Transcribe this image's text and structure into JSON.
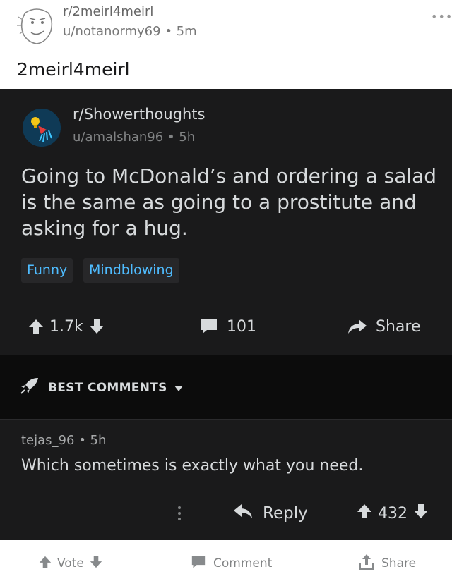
{
  "outer": {
    "subreddit": "r/2meirl4meirl",
    "user": "u/notanormy69",
    "time": "5m",
    "meta_sep": "•",
    "title": "2meirl4meirl",
    "more": "•••"
  },
  "embedded": {
    "subreddit": "r/Showerthoughts",
    "user": "u/amalshan96",
    "time": "5h",
    "meta_sep": "•",
    "body": "Going to McDonald’s and ordering a salad is the same as going to a prostitute and asking for a hug.",
    "flairs": [
      "Funny",
      "Mindblowing"
    ],
    "votes": "1.7k",
    "comments": "101",
    "share_label": "Share",
    "sort_label": "BEST COMMENTS",
    "comment": {
      "author": "tejas_96",
      "meta_sep": "•",
      "time": "5h",
      "text": "Which sometimes is exactly what you need.",
      "reply_label": "Reply",
      "votes": "432"
    }
  },
  "footer": {
    "vote_label": "Vote",
    "comment_label": "Comment",
    "share_label": "Share"
  },
  "icons": {
    "avatar": "rage-face-avatar-icon",
    "more": "more-options-icon",
    "sub_icon": "lightbulb-shower-icon",
    "upvote": "upvote-arrow-icon",
    "downvote": "downvote-arrow-icon",
    "comment": "comment-bubble-icon",
    "share": "share-arrow-icon",
    "sort": "rocket-icon",
    "reply": "reply-arrow-icon",
    "share_footer": "share-upload-icon"
  },
  "colors": {
    "dark_bg": "#1a1a1b",
    "text_light": "#d7dadc",
    "flair_text": "#4fbcff",
    "muted": "#818384"
  }
}
